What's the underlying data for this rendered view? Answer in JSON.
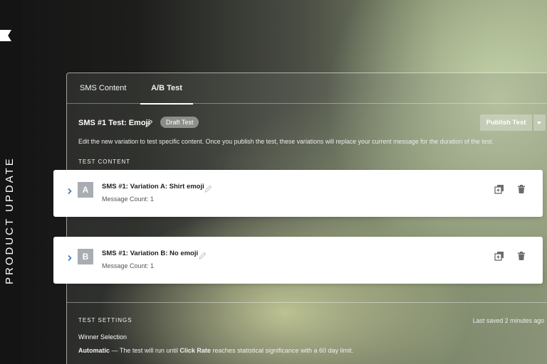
{
  "side_label": "PRODUCT UPDATE",
  "tabs": [
    {
      "label": "SMS Content",
      "active": false
    },
    {
      "label": "A/B Test",
      "active": true
    }
  ],
  "test": {
    "title": "SMS #1 Test: Emoji",
    "status_badge": "Draft Test",
    "publish_label": "Publish Test",
    "description": "Edit the new variation to test specific content. Once you publish the test, these variations will replace your current message for the duration of the test."
  },
  "content_section_label": "TEST CONTENT",
  "variations": [
    {
      "letter": "A",
      "title": "SMS #1: Variation A: Shirt emoji",
      "count": "Message Count: 1"
    },
    {
      "letter": "B",
      "title": "SMS #1: Variation B: No emoji",
      "count": "Message Count: 1"
    }
  ],
  "settings": {
    "section_label": "TEST SETTINGS",
    "last_saved": "Last saved 2 minutes ago",
    "winner_label": "Winner Selection",
    "automatic_label": "Automatic",
    "automatic_text_1": " — The test will run until ",
    "metric": "Click Rate",
    "automatic_text_2": " reaches statistical significance with a 60 day limit."
  },
  "icons": {
    "flag": "flag-icon",
    "edit": "pencil-icon",
    "expand": "chevron-right-icon",
    "duplicate": "duplicate-icon",
    "delete": "trash-icon",
    "dropdown": "caret-down-icon"
  },
  "colors": {
    "accent_chevron": "#3a78b5",
    "badge_gray": "#a8adb3"
  }
}
